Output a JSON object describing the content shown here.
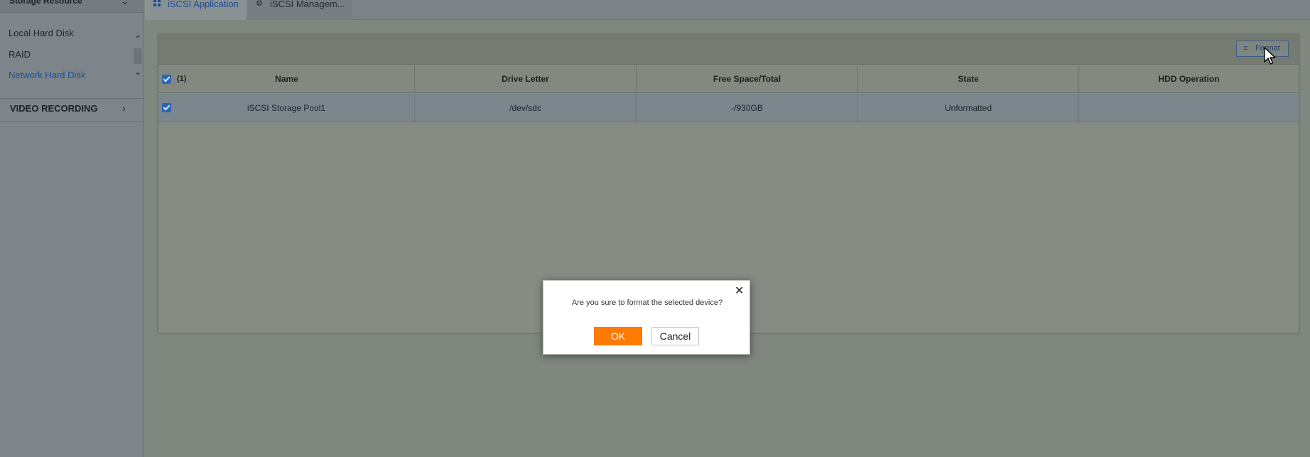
{
  "sidebar": {
    "section_title": "Storage Resource",
    "items": [
      {
        "label": "Local Hard Disk",
        "active": false
      },
      {
        "label": "RAID",
        "active": false
      },
      {
        "label": "Network Hard Disk",
        "active": true
      }
    ],
    "video_recording": "VIDEO RECORDING"
  },
  "tabs": [
    {
      "label": "iSCSI Application",
      "icon": "grid-icon",
      "active": true
    },
    {
      "label": "iSCSI Managem...",
      "icon": "gear-icon",
      "active": false
    }
  ],
  "toolbar": {
    "format_label": "Format"
  },
  "table": {
    "selected_count": "(1)",
    "headers": [
      "Name",
      "Drive Letter",
      "Free Space/Total",
      "State",
      "HDD Operation"
    ],
    "rows": [
      {
        "checked": true,
        "name": "iSCSI Storage Pool1",
        "drive_letter": "/dev/sdc",
        "free_space": "-/930GB",
        "state": "Unformatted",
        "hdd_operation": ""
      }
    ]
  },
  "dialog": {
    "message": "Are you sure to format the selected device?",
    "ok_label": "OK",
    "cancel_label": "Cancel"
  },
  "colors": {
    "accent": "#1a4fa0",
    "ok_button": "#ff7a00"
  }
}
